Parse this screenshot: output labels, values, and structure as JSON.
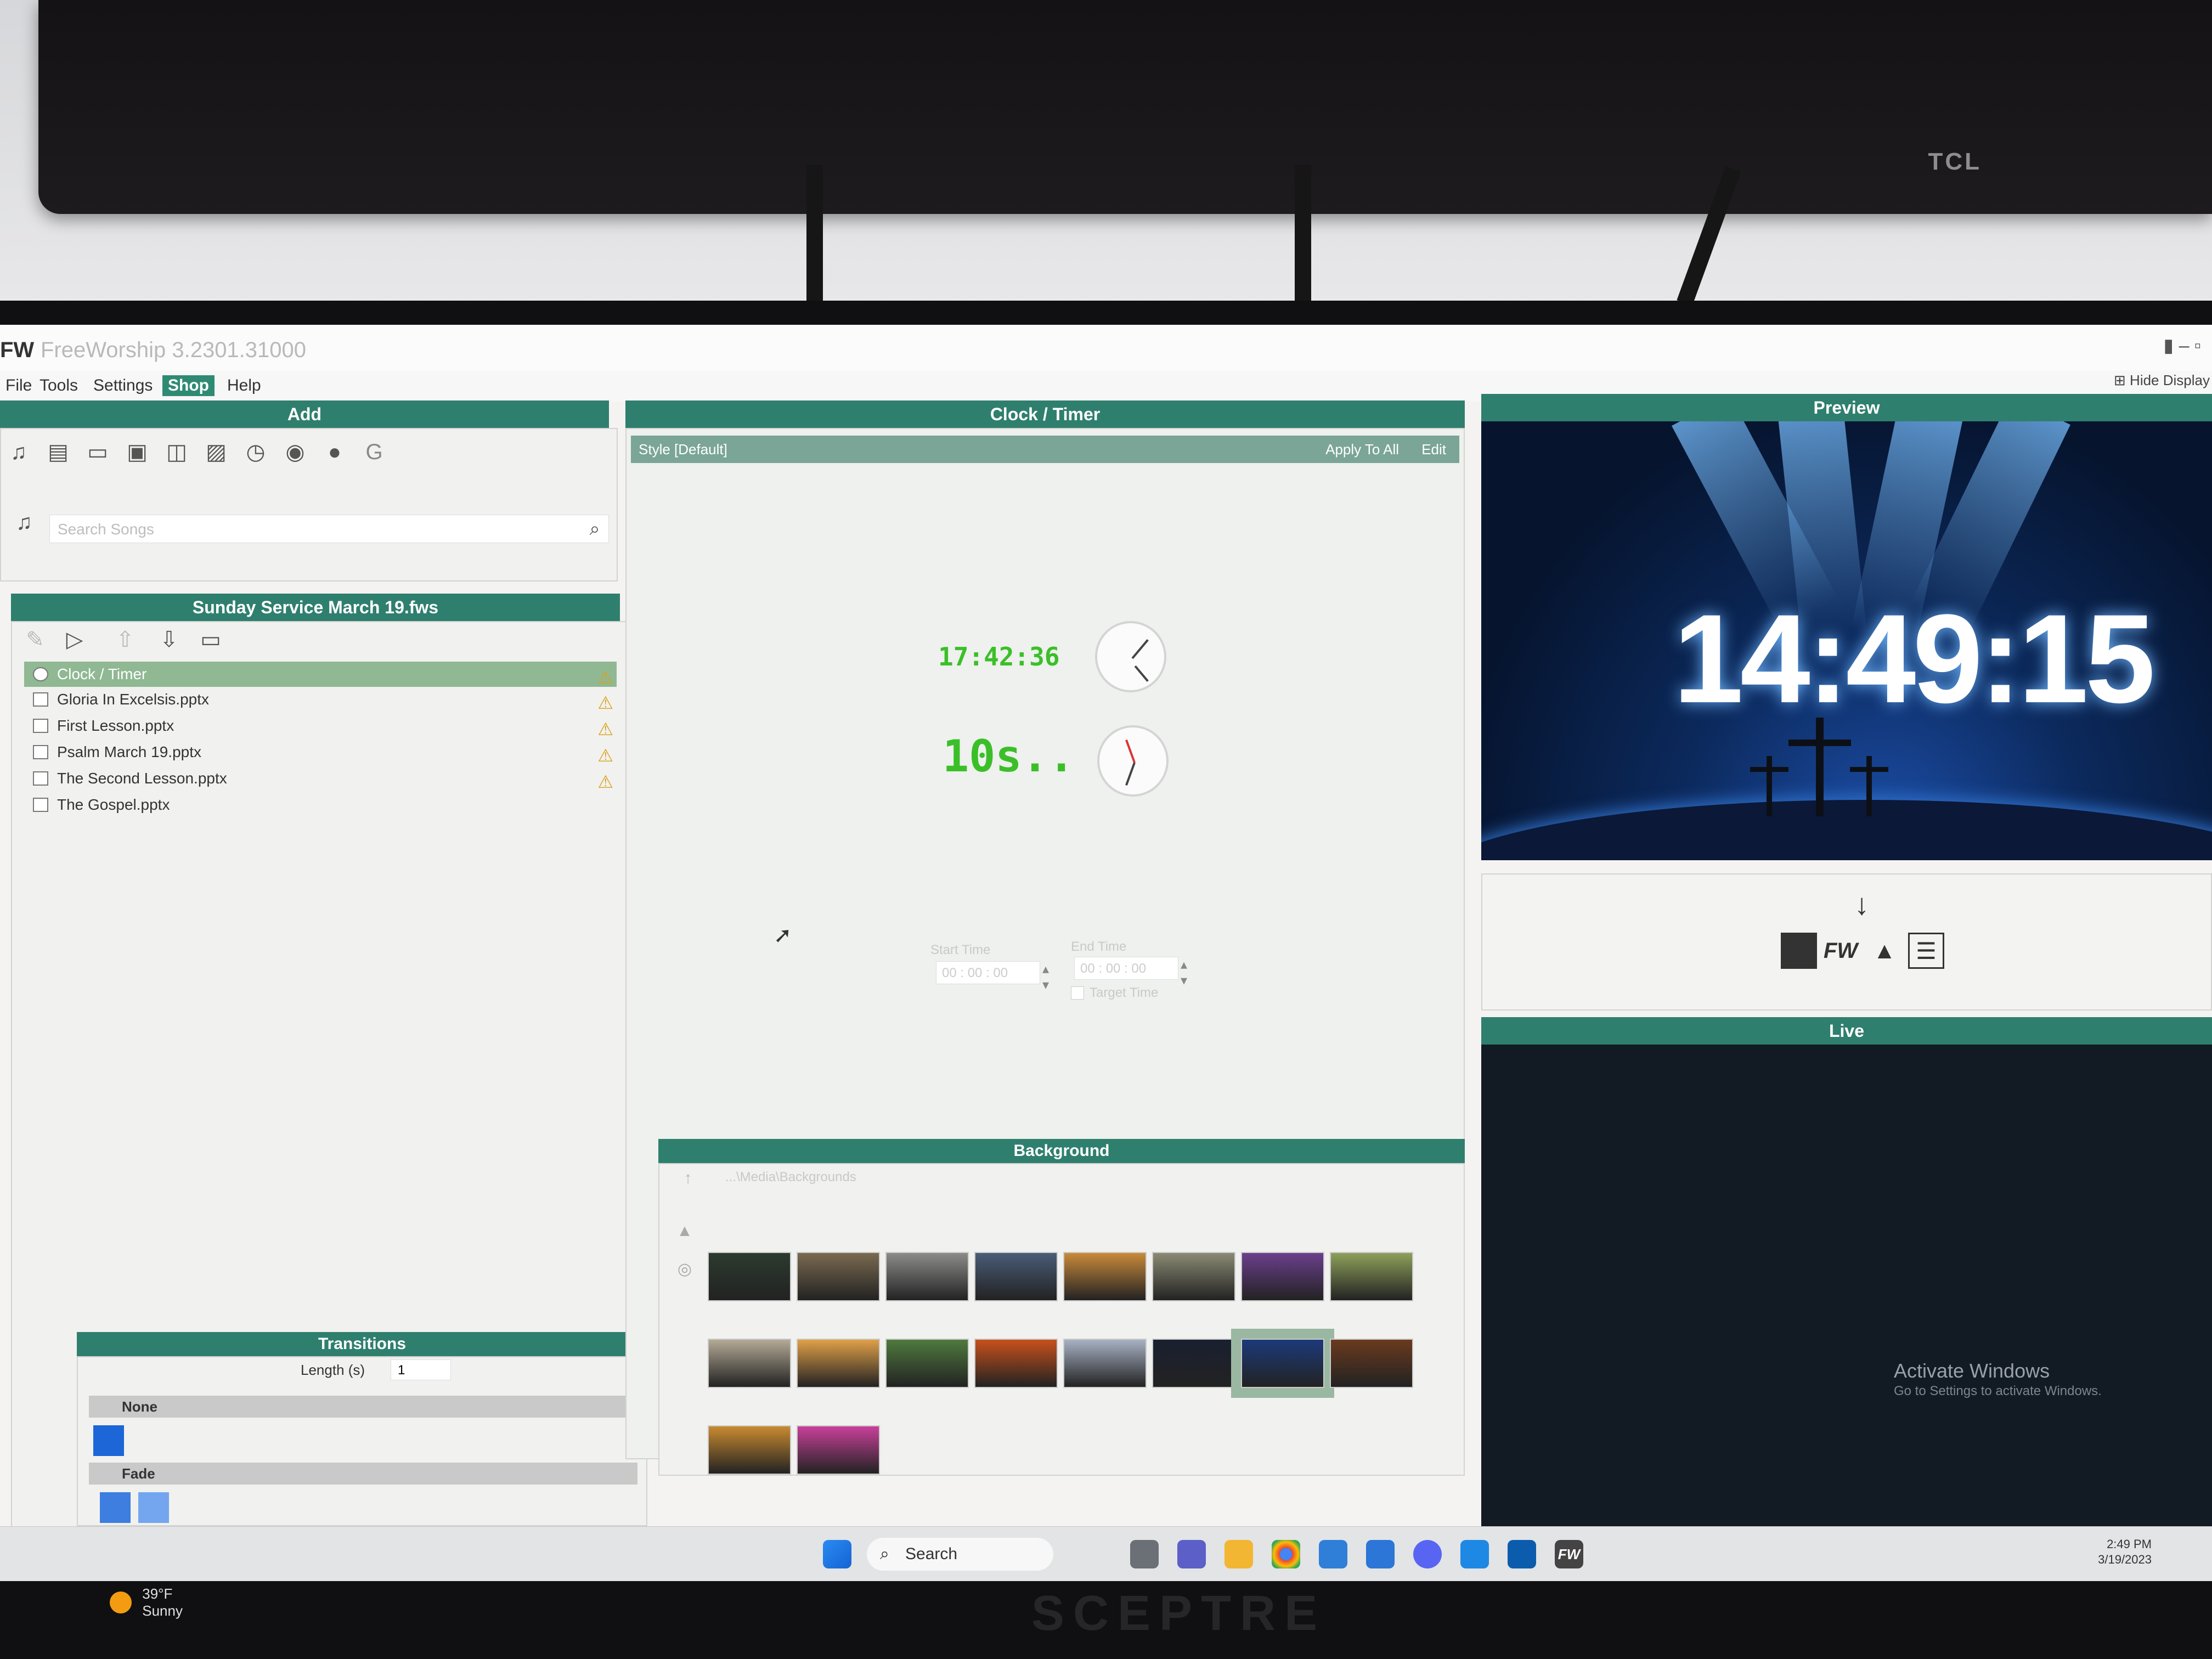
{
  "environment": {
    "tv_brand": "TCL",
    "monitor_brand": "SCEPTRE"
  },
  "app": {
    "logo": "FW",
    "title": "FreeWorship 3.2301.31000",
    "menu": [
      "File",
      "Tools",
      "Settings",
      "Shop",
      "Help"
    ],
    "active_menu": "Shop",
    "hide_display_label": "Hide Display"
  },
  "add_panel": {
    "header": "Add",
    "tool_icons": [
      "music-icon",
      "document-icon",
      "presentation-icon",
      "video-icon",
      "slides-icon",
      "image-icon",
      "clock-icon",
      "webcam-icon",
      "web-icon",
      "google-icon"
    ],
    "search_placeholder": "Search Songs"
  },
  "service": {
    "header": "Sunday Service March 19.fws",
    "toolbar_icons": [
      "edit-icon",
      "tag-icon",
      "move-up-icon",
      "move-down-icon",
      "remove-icon"
    ],
    "items": [
      {
        "label": "Clock / Timer",
        "icon": "clock-icon",
        "selected": true,
        "warning": true
      },
      {
        "label": "Gloria In Excelsis.pptx",
        "icon": "pptx-icon",
        "selected": false,
        "warning": true
      },
      {
        "label": "First Lesson.pptx",
        "icon": "pptx-icon",
        "selected": false,
        "warning": true
      },
      {
        "label": "Psalm March 19.pptx",
        "icon": "pptx-icon",
        "selected": false,
        "warning": true
      },
      {
        "label": "The Second Lesson.pptx",
        "icon": "pptx-icon",
        "selected": false,
        "warning": true
      },
      {
        "label": "The Gospel.pptx",
        "icon": "pptx-icon",
        "selected": false,
        "warning": false
      }
    ]
  },
  "transitions": {
    "header": "Transitions",
    "length_label": "Length (s)",
    "length_value": "1",
    "groups": [
      "None",
      "Fade"
    ]
  },
  "clock_timer": {
    "header": "Clock / Timer",
    "style_label": "Style [Default]",
    "apply_all_label": "Apply To All",
    "edit_label": "Edit",
    "digital_clock_sample": "17:42:36",
    "timer_sample": "10s..",
    "start_time_label": "Start Time",
    "start_time_value": "00 : 00 : 00",
    "end_time_label": "End Time",
    "end_time_value": "00 : 00 : 00",
    "target_time_label": "Target Time"
  },
  "background": {
    "header": "Background",
    "path": "...\\Media\\Backgrounds",
    "selected_index": 14,
    "thumbnails": [
      "#2c3a2e",
      "#7a6a50",
      "#8b8c8a",
      "#4a5c78",
      "#c98a3a",
      "#8a8a74",
      "#6b3f8c",
      "#8ea05a",
      "#b4aa96",
      "#e0a048",
      "#4f7a3e",
      "#c8501c",
      "#a8b2c4",
      "#1a2030",
      "#1c3a7a",
      "#6a3a1e",
      "#c88a30",
      "#c8409a"
    ]
  },
  "preview": {
    "header": "Preview",
    "clock_text": "14:49:15",
    "controls": [
      "black-screen-button",
      "logo-button",
      "background-button",
      "clear-text-button"
    ],
    "logo_label": "FW"
  },
  "live": {
    "header": "Live",
    "watermark_title": "Activate Windows",
    "watermark_sub": "Go to Settings to activate Windows."
  },
  "taskbar": {
    "search_label": "Search",
    "time": "2:49 PM",
    "date": "3/19/2023",
    "weather_temp": "39°F",
    "weather_desc": "Sunny"
  }
}
